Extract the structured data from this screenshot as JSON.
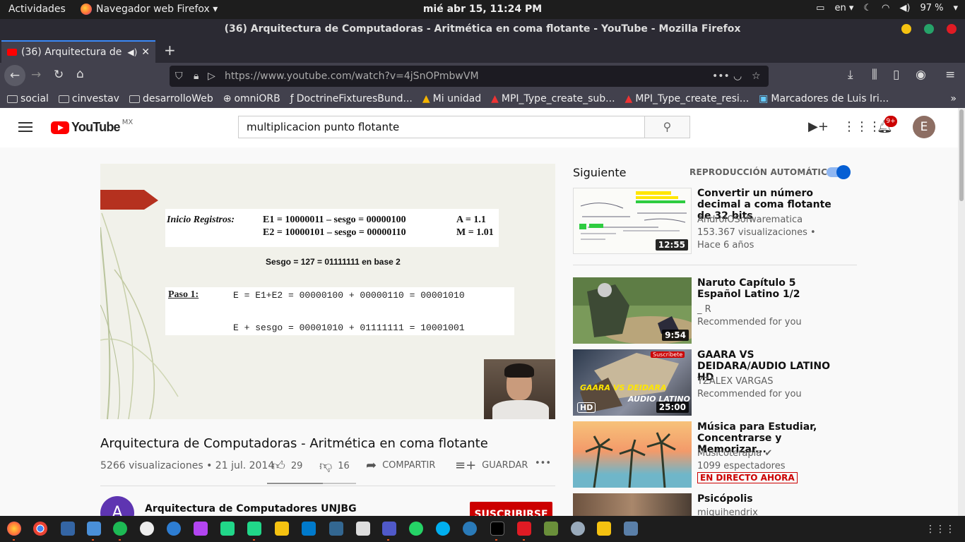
{
  "topbar": {
    "activities": "Actividades",
    "app": "Navegador web Firefox ▾",
    "clock": "mié abr 15, 11:24 PM",
    "lang": "en ▾",
    "battery": "97 %"
  },
  "window": {
    "title": "(36) Arquitectura de Computadoras - Aritmética en coma flotante - YouTube - Mozilla Firefox"
  },
  "tab": {
    "label": "(36) Arquitectura de Co"
  },
  "url": "https://www.youtube.com/watch?v=4jSnOPmbwVM",
  "bookmarks": [
    "social",
    "cinvestav",
    "desarrolloWeb",
    "omniORB",
    "DoctrineFixturesBund...",
    "Mi unidad",
    "MPI_Type_create_sub...",
    "MPI_Type_create_resi...",
    "Marcadores de Luis Iri..."
  ],
  "youtube": {
    "logo": "YouTube",
    "region": "MX",
    "search_value": "multiplicacion punto flotante",
    "notifications": "9+",
    "avatar_letter": "E"
  },
  "slide": {
    "label": "Inicio Registros:",
    "row1": "E1 = 10000011 – sesgo = 00000100",
    "row2": "E2 = 10000101 – sesgo =  00000110",
    "a": "A = 1.1",
    "m": "M = 1.01",
    "sesgo": "Sesgo = 127 = 01111111 en base 2",
    "paso": "Paso 1:",
    "eq1": "E = E1+E2 = 00000100 + 00000110 = 00001010",
    "eq2": "E + sesgo = 00001010 + 01111111 = 10001001"
  },
  "video": {
    "title": "Arquitectura de Computadoras - Aritmética en coma flotante",
    "stats": "5266 visualizaciones • 21 jul. 2014",
    "likes": "29",
    "dislikes": "16",
    "like_ratio": 0.63,
    "share": "COMPARTIR",
    "save": "GUARDAR",
    "more": "•••",
    "channel_initial": "A",
    "channel": "Arquitectura de Computadores UNJBG",
    "subscribe": "SUSCRIBIRSE"
  },
  "upnext": {
    "heading": "Siguiente",
    "autoplay": "REPRODUCCIÓN AUTOMÁTICA",
    "autoplay_on": true,
    "items": [
      {
        "title": "Convertir un número decimal a coma flotante de 32 bits",
        "channel": "AndroIOSofwarematica",
        "meta1": "153.367 visualizaciones •",
        "meta2": "Hace 6 años",
        "duration": "12:55"
      },
      {
        "title": "Naruto Capítulo 5 Español Latino 1/2",
        "channel": "_ R",
        "meta1": "Recommended for you",
        "duration": "9:54"
      },
      {
        "title": "GAARA VS DEIDARA/AUDIO LATINO HD",
        "channel": "YZALEX VARGAS",
        "meta1": "Recommended for you",
        "duration": "25:00",
        "thumb_top": "GAARA VS DEIDARA",
        "thumb_bottom": "AUDIO LATINO",
        "thumb_badge": "Suscríbete",
        "hd": "HD"
      },
      {
        "title": "Música para Estudiar, Concentrarse y Memorizar...",
        "channel": "Musicoterapia",
        "meta1": "1099 espectadores",
        "live": "EN DIRECTO AHORA"
      },
      {
        "title": "Psicópolis",
        "channel": "miguihendrix"
      }
    ]
  }
}
